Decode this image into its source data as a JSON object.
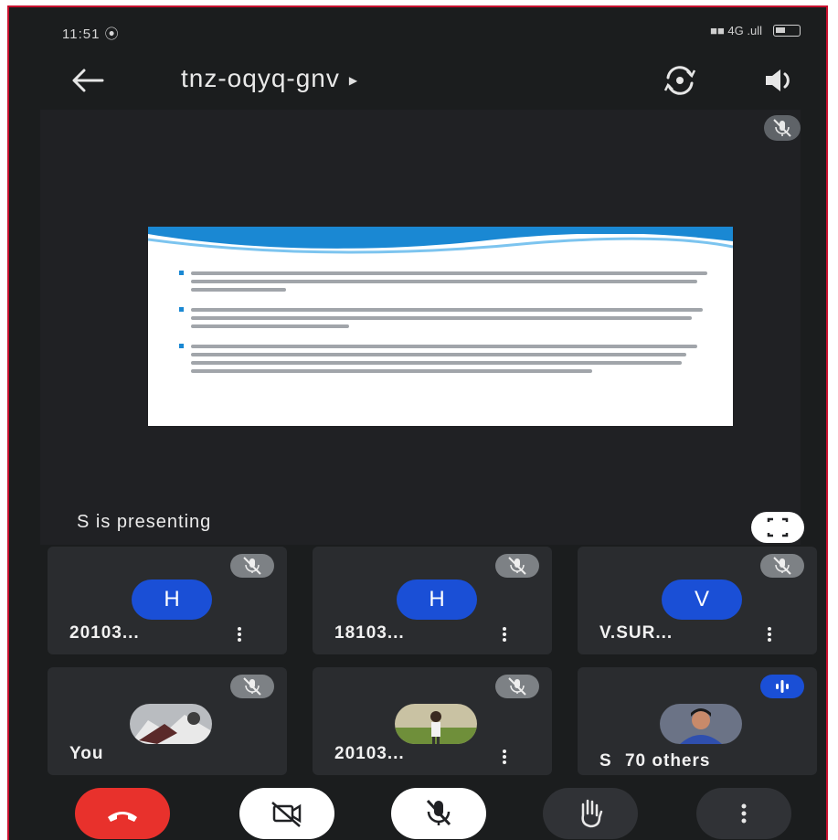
{
  "status_bar": {
    "time": "11:51",
    "indicators": "■■  4G  .ull"
  },
  "header": {
    "meeting_code": "tnz-oqyq-gnv",
    "back_icon": "arrow-left-icon",
    "switch_camera_icon": "camera-switch-icon",
    "speaker_icon": "speaker-icon"
  },
  "stage": {
    "presenting_text": "S is presenting"
  },
  "participants": [
    {
      "name": "20103...",
      "initial": "H",
      "type": "initial"
    },
    {
      "name": "18103...",
      "initial": "H",
      "type": "initial"
    },
    {
      "name": "V.SUR...",
      "initial": "V",
      "type": "initial"
    },
    {
      "name": "You",
      "type": "photo"
    },
    {
      "name": "20103...",
      "type": "photo"
    },
    {
      "name": "S",
      "others": "70 others",
      "type": "photo"
    }
  ],
  "colors": {
    "accent_blue": "#1a4fd6",
    "end_call_red": "#e8312c",
    "background": "#1b1d1e",
    "tile": "#2a2c2f"
  }
}
